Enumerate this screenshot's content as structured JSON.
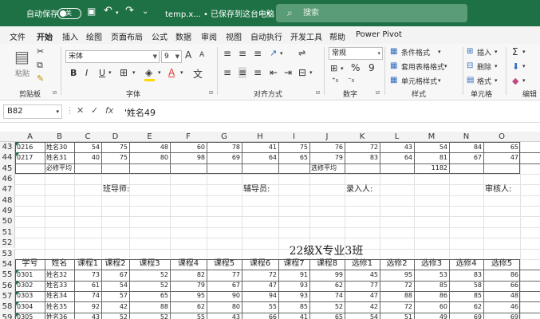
{
  "titlebar": {
    "autosave_label": "自动保存",
    "autosave_state": "关",
    "filename": "temp.x... • 已保存到这台电脑",
    "search_placeholder": "搜索"
  },
  "menu": {
    "tabs": [
      "文件",
      "开始",
      "插入",
      "绘图",
      "页面布局",
      "公式",
      "数据",
      "审阅",
      "视图",
      "自动执行",
      "开发工具",
      "帮助",
      "Power Pivot"
    ],
    "active": "开始"
  },
  "ribbon": {
    "clipboard": {
      "paste": "粘贴",
      "label": "剪贴板"
    },
    "font": {
      "name": "宋体",
      "size": "9",
      "label": "字体",
      "bold": "B",
      "italic": "I",
      "underline": "U",
      "grow": "A",
      "shrink": "A",
      "color_letter": "A",
      "font_color": "#e03c31",
      "fill_color": "#ffd800"
    },
    "alignment": {
      "label": "对齐方式"
    },
    "number": {
      "format": "常规",
      "label": "数字",
      "percent": "%",
      "comma": "9"
    },
    "styles": {
      "conditional": "条件格式",
      "table": "套用表格格式",
      "cell": "单元格样式",
      "label": "样式"
    },
    "cells": {
      "insert": "插入",
      "delete": "删除",
      "format": "格式",
      "label": "单元格"
    },
    "editing": {
      "label": "编辑"
    }
  },
  "formula_bar": {
    "name_box": "B82",
    "value": "'姓名49",
    "cancel": "✕",
    "enter": "✓",
    "fx": "fx"
  },
  "columns": [
    "A",
    "B",
    "C",
    "D",
    "E",
    "F",
    "G",
    "H",
    "I",
    "J",
    "K",
    "L",
    "M",
    "N",
    "O"
  ],
  "row_numbers": [
    "43",
    "44",
    "45",
    "46",
    "47",
    "48",
    "49",
    "50",
    "51",
    "52",
    "53",
    "54",
    "55",
    "56",
    "57",
    "58",
    "59"
  ],
  "sheet": {
    "r43": [
      "0216",
      "姓名30",
      "54",
      "75",
      "48",
      "60",
      "78",
      "41",
      "75",
      "76",
      "72",
      "43",
      "54",
      "84",
      "65"
    ],
    "r44": [
      "0217",
      "姓名31",
      "40",
      "75",
      "80",
      "98",
      "69",
      "64",
      "65",
      "79",
      "83",
      "64",
      "81",
      "67",
      "47"
    ],
    "r45_req_avg": "必修平均",
    "r45_elective_avg": "选修平均",
    "r45_value": "1182",
    "r47": {
      "class_teacher": "班导师:",
      "tutor": "辅导员:",
      "entry": "录入人:",
      "reviewer": "审核人:"
    },
    "title": "22级X专业3班",
    "headers": [
      "学号",
      "姓名",
      "课程1",
      "课程2",
      "课程3",
      "课程4",
      "课程5",
      "课程6",
      "课程7",
      "课程8",
      "选修1",
      "选修2",
      "选修3",
      "选修4",
      "选修5"
    ],
    "r55": [
      "0301",
      "姓名32",
      "73",
      "67",
      "52",
      "82",
      "77",
      "72",
      "91",
      "99",
      "45",
      "95",
      "53",
      "83",
      "86"
    ],
    "r56": [
      "0302",
      "姓名33",
      "61",
      "54",
      "52",
      "79",
      "67",
      "47",
      "93",
      "62",
      "77",
      "72",
      "85",
      "58",
      "66"
    ],
    "r57": [
      "0303",
      "姓名34",
      "74",
      "57",
      "65",
      "95",
      "90",
      "94",
      "93",
      "74",
      "47",
      "88",
      "86",
      "85",
      "48"
    ],
    "r58": [
      "0304",
      "姓名35",
      "92",
      "42",
      "88",
      "62",
      "80",
      "55",
      "85",
      "52",
      "42",
      "72",
      "60",
      "62",
      "46"
    ],
    "r59": [
      "0305",
      "姓名36",
      "43",
      "52",
      "52",
      "55",
      "43",
      "66",
      "41",
      "65",
      "54",
      "51",
      "49",
      "69",
      "69"
    ]
  }
}
